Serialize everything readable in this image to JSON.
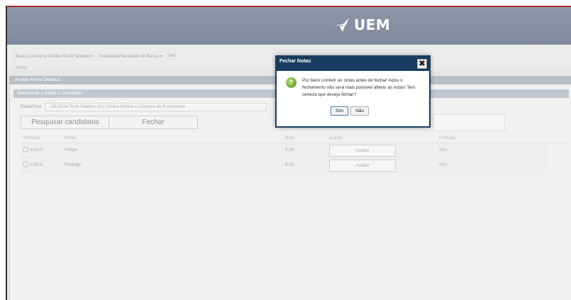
{
  "header": {
    "logo_text": "UEM",
    "logo_icon": "uem-emblem-icon"
  },
  "menu": {
    "items": [
      {
        "label": "Banca Concurso Público/Teste Seletivo",
        "has_dropdown": true
      },
      {
        "label": "Presidente/Secretário de Banca",
        "has_dropdown": true
      },
      {
        "label": "Sair",
        "has_dropdown": false
      }
    ],
    "user_label": "Nome"
  },
  "panel": {
    "title": "Avaliar Prova Didática",
    "section_title": "Selecionar o Edital e Candidato",
    "edital_label": "Edital/Área",
    "edital_value": "131/2024-Teste Seletivo-(01) Clínica Médica e Cirúrgica de Ruminantes",
    "search_button": "Pesquisar candidatos",
    "close_button": "Fechar"
  },
  "table": {
    "headers": [
      "Inscrição",
      "Nome",
      "Nota",
      "Avaliar",
      "Fechado"
    ],
    "rows": [
      {
        "inscricao": "13924",
        "nome": "Felipe",
        "nota": "8.50",
        "avaliar": "Avaliar",
        "fechado": "Sim"
      },
      {
        "inscricao": "13926",
        "nome": "Rodrigo",
        "nota": "8.50",
        "avaliar": "Avaliar",
        "fechado": "Sim"
      }
    ]
  },
  "dialog": {
    "title": "Fechar Notas",
    "close_symbol": "✖",
    "icon": "question-icon",
    "message": "Por favor conferir as notas antes de fechar! Após o fechamento não será mais possível alterar as notas! Tem certeza que deseja fechar?",
    "yes_button": "Sim",
    "no_button": "Não"
  },
  "colors": {
    "banner": "#8e97a7",
    "dialog_title": "#173c60",
    "panel_title": "#b9bfc9"
  }
}
